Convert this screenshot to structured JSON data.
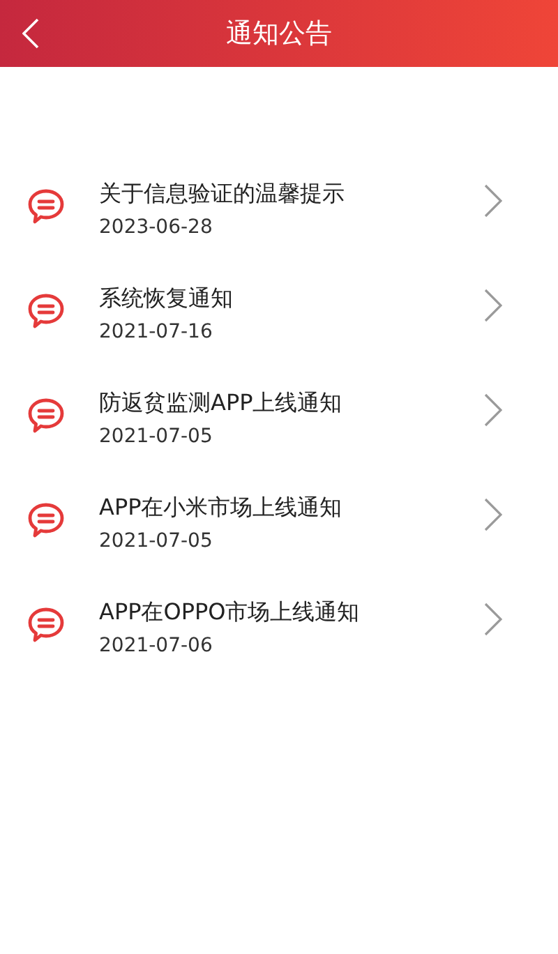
{
  "header": {
    "title": "通知公告"
  },
  "notices": [
    {
      "title": "关于信息验证的温馨提示",
      "date": "2023-06-28"
    },
    {
      "title": "系统恢复通知",
      "date": "2021-07-16"
    },
    {
      "title": "防返贫监测APP上线通知",
      "date": "2021-07-05"
    },
    {
      "title": "APP在小米市场上线通知",
      "date": "2021-07-05"
    },
    {
      "title": "APP在OPPO市场上线通知",
      "date": "2021-07-06"
    }
  ]
}
